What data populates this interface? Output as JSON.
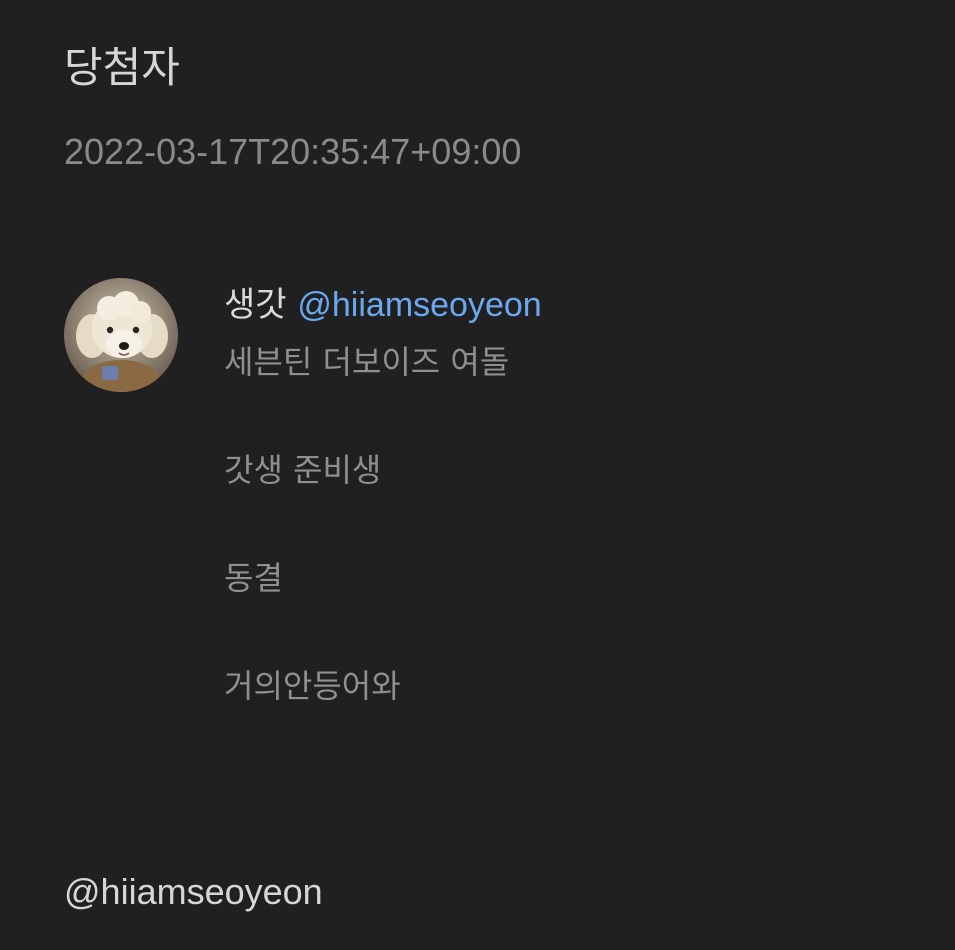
{
  "header": {
    "title": "당첨자",
    "timestamp": "2022-03-17T20:35:47+09:00"
  },
  "profile": {
    "avatar_icon": "puppy-avatar-icon",
    "display_name": "생갓",
    "handle": "@hiiamseoyeon",
    "bio_lines": [
      "세븐틴 더보이즈 여돌",
      "갓생 준비생",
      "동결",
      "거의안등어와"
    ]
  },
  "footer": {
    "handle": "@hiiamseoyeon"
  },
  "colors": {
    "background": "#202020",
    "link": "#6aa8f0",
    "primary_text": "#d6d6d6",
    "secondary_text": "#8a8a8a"
  }
}
